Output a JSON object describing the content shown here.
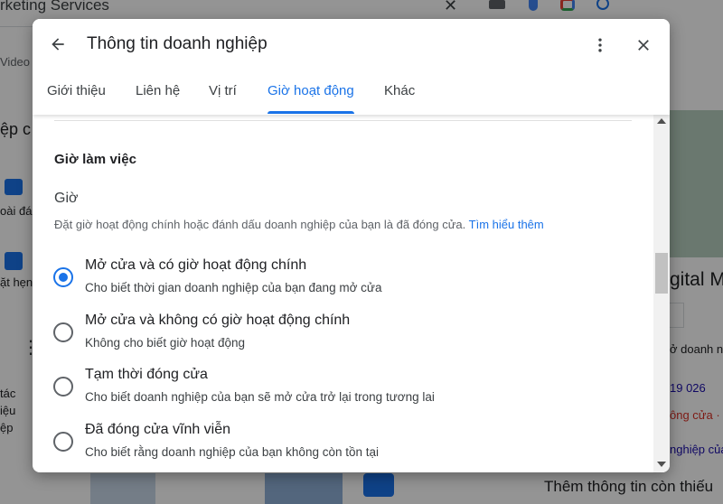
{
  "background": {
    "search_text": "rketing Services",
    "video_label": "Video",
    "left_heading": "ệp c",
    "left_text_1": "oài đá",
    "left_text_2": "ặt hẹn",
    "left_text_3_lines": [
      "tác",
      "iệu",
      "ệp"
    ],
    "right_heading": "gital M",
    "right_text_1": "ở doanh n",
    "right_text_2": "19 026",
    "right_text_3": "ông cửa ·",
    "right_text_4": "nghiệp của",
    "bottom_text": "Thêm thông tin còn thiếu"
  },
  "dialog": {
    "title": "Thông tin doanh nghiệp",
    "tabs": [
      {
        "label": "Giới thiệu",
        "active": false
      },
      {
        "label": "Liên hệ",
        "active": false
      },
      {
        "label": "Vị trí",
        "active": false
      },
      {
        "label": "Giờ hoạt động",
        "active": true
      },
      {
        "label": "Khác",
        "active": false
      }
    ],
    "section_title": "Giờ làm việc",
    "sub_title": "Giờ",
    "description": "Đặt giờ hoạt động chính hoặc đánh dấu doanh nghiệp của bạn là đã đóng cửa.",
    "learn_more": "Tìm hiểu thêm",
    "options": [
      {
        "label": "Mở cửa và có giờ hoạt động chính",
        "description": "Cho biết thời gian doanh nghiệp của bạn đang mở cửa",
        "selected": true
      },
      {
        "label": "Mở cửa và không có giờ hoạt động chính",
        "description": "Không cho biết giờ hoạt động",
        "selected": false
      },
      {
        "label": "Tạm thời đóng cửa",
        "description": "Cho biết doanh nghiệp của bạn sẽ mở cửa trở lại trong tương lai",
        "selected": false
      },
      {
        "label": "Đã đóng cửa vĩnh viễn",
        "description": "Cho biết rằng doanh nghiệp của bạn không còn tồn tại",
        "selected": false
      }
    ]
  },
  "colors": {
    "accent": "#1a73e8",
    "text_primary": "#202124",
    "text_secondary": "#5f6368"
  },
  "icons": {
    "back": "arrow-left-icon",
    "more": "more-vert-icon",
    "close": "close-icon"
  }
}
